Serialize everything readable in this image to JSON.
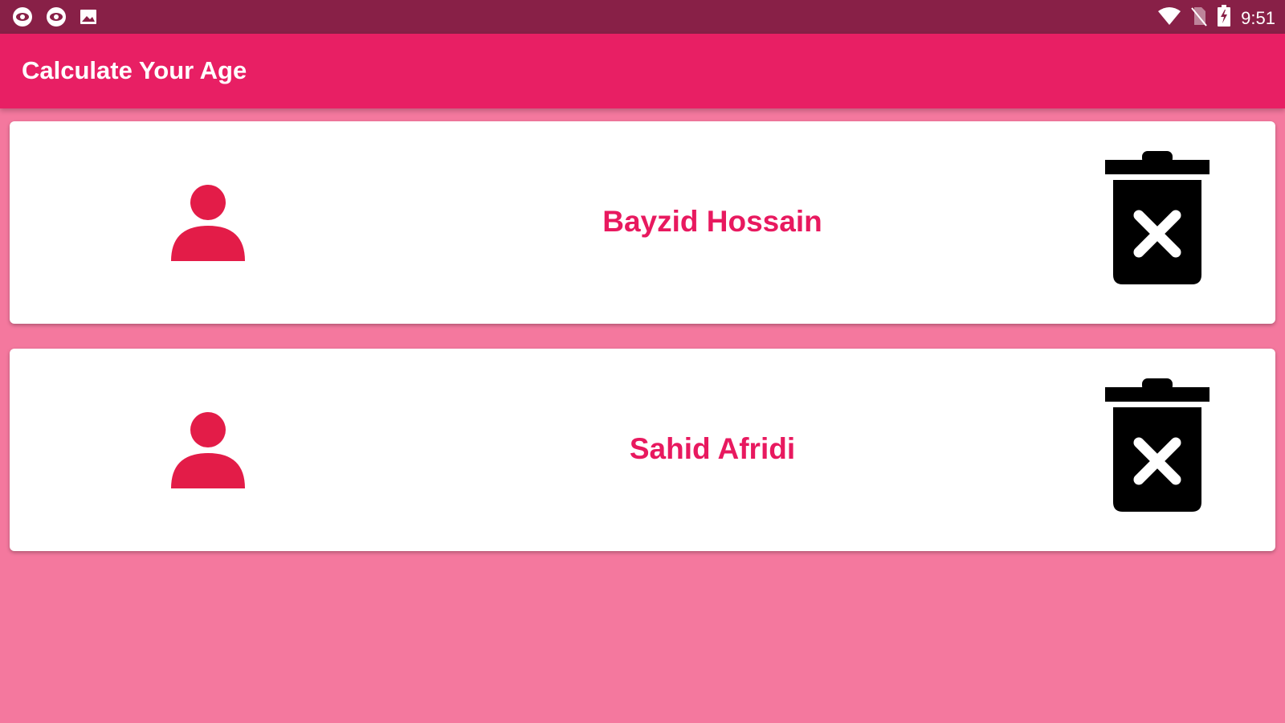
{
  "status_bar": {
    "left_icons": [
      "eye-notification-icon",
      "eye-notification-icon",
      "image-notification-icon"
    ],
    "right_icons": [
      "wifi-icon",
      "no-sim-icon",
      "battery-charging-icon"
    ],
    "time": "9:51"
  },
  "app_bar": {
    "title": "Calculate Your Age"
  },
  "people": [
    {
      "name": "Bayzid Hossain",
      "avatar_icon": "person-icon",
      "action_icon": "delete-icon"
    },
    {
      "name": "Sahid Afridi",
      "avatar_icon": "person-icon",
      "action_icon": "delete-icon"
    }
  ],
  "colors": {
    "status_bar": "#882047",
    "app_bar": "#E81F64",
    "background": "#F4789E",
    "accent": "#E8195F",
    "avatar": "#E31C48"
  }
}
